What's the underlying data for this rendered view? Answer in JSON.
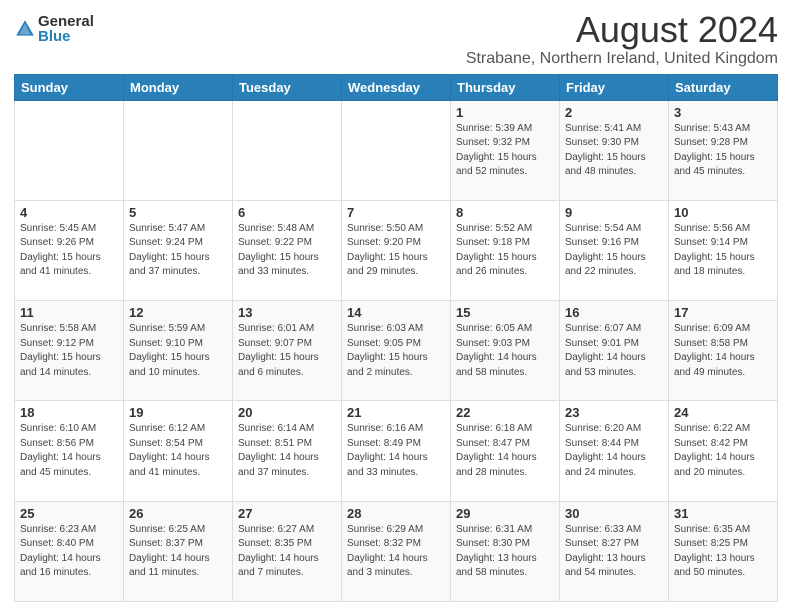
{
  "logo": {
    "general": "General",
    "blue": "Blue"
  },
  "header": {
    "title": "August 2024",
    "subtitle": "Strabane, Northern Ireland, United Kingdom"
  },
  "weekdays": [
    "Sunday",
    "Monday",
    "Tuesday",
    "Wednesday",
    "Thursday",
    "Friday",
    "Saturday"
  ],
  "weeks": [
    [
      {
        "day": "",
        "info": ""
      },
      {
        "day": "",
        "info": ""
      },
      {
        "day": "",
        "info": ""
      },
      {
        "day": "",
        "info": ""
      },
      {
        "day": "1",
        "info": "Sunrise: 5:39 AM\nSunset: 9:32 PM\nDaylight: 15 hours\nand 52 minutes."
      },
      {
        "day": "2",
        "info": "Sunrise: 5:41 AM\nSunset: 9:30 PM\nDaylight: 15 hours\nand 48 minutes."
      },
      {
        "day": "3",
        "info": "Sunrise: 5:43 AM\nSunset: 9:28 PM\nDaylight: 15 hours\nand 45 minutes."
      }
    ],
    [
      {
        "day": "4",
        "info": "Sunrise: 5:45 AM\nSunset: 9:26 PM\nDaylight: 15 hours\nand 41 minutes."
      },
      {
        "day": "5",
        "info": "Sunrise: 5:47 AM\nSunset: 9:24 PM\nDaylight: 15 hours\nand 37 minutes."
      },
      {
        "day": "6",
        "info": "Sunrise: 5:48 AM\nSunset: 9:22 PM\nDaylight: 15 hours\nand 33 minutes."
      },
      {
        "day": "7",
        "info": "Sunrise: 5:50 AM\nSunset: 9:20 PM\nDaylight: 15 hours\nand 29 minutes."
      },
      {
        "day": "8",
        "info": "Sunrise: 5:52 AM\nSunset: 9:18 PM\nDaylight: 15 hours\nand 26 minutes."
      },
      {
        "day": "9",
        "info": "Sunrise: 5:54 AM\nSunset: 9:16 PM\nDaylight: 15 hours\nand 22 minutes."
      },
      {
        "day": "10",
        "info": "Sunrise: 5:56 AM\nSunset: 9:14 PM\nDaylight: 15 hours\nand 18 minutes."
      }
    ],
    [
      {
        "day": "11",
        "info": "Sunrise: 5:58 AM\nSunset: 9:12 PM\nDaylight: 15 hours\nand 14 minutes."
      },
      {
        "day": "12",
        "info": "Sunrise: 5:59 AM\nSunset: 9:10 PM\nDaylight: 15 hours\nand 10 minutes."
      },
      {
        "day": "13",
        "info": "Sunrise: 6:01 AM\nSunset: 9:07 PM\nDaylight: 15 hours\nand 6 minutes."
      },
      {
        "day": "14",
        "info": "Sunrise: 6:03 AM\nSunset: 9:05 PM\nDaylight: 15 hours\nand 2 minutes."
      },
      {
        "day": "15",
        "info": "Sunrise: 6:05 AM\nSunset: 9:03 PM\nDaylight: 14 hours\nand 58 minutes."
      },
      {
        "day": "16",
        "info": "Sunrise: 6:07 AM\nSunset: 9:01 PM\nDaylight: 14 hours\nand 53 minutes."
      },
      {
        "day": "17",
        "info": "Sunrise: 6:09 AM\nSunset: 8:58 PM\nDaylight: 14 hours\nand 49 minutes."
      }
    ],
    [
      {
        "day": "18",
        "info": "Sunrise: 6:10 AM\nSunset: 8:56 PM\nDaylight: 14 hours\nand 45 minutes."
      },
      {
        "day": "19",
        "info": "Sunrise: 6:12 AM\nSunset: 8:54 PM\nDaylight: 14 hours\nand 41 minutes."
      },
      {
        "day": "20",
        "info": "Sunrise: 6:14 AM\nSunset: 8:51 PM\nDaylight: 14 hours\nand 37 minutes."
      },
      {
        "day": "21",
        "info": "Sunrise: 6:16 AM\nSunset: 8:49 PM\nDaylight: 14 hours\nand 33 minutes."
      },
      {
        "day": "22",
        "info": "Sunrise: 6:18 AM\nSunset: 8:47 PM\nDaylight: 14 hours\nand 28 minutes."
      },
      {
        "day": "23",
        "info": "Sunrise: 6:20 AM\nSunset: 8:44 PM\nDaylight: 14 hours\nand 24 minutes."
      },
      {
        "day": "24",
        "info": "Sunrise: 6:22 AM\nSunset: 8:42 PM\nDaylight: 14 hours\nand 20 minutes."
      }
    ],
    [
      {
        "day": "25",
        "info": "Sunrise: 6:23 AM\nSunset: 8:40 PM\nDaylight: 14 hours\nand 16 minutes."
      },
      {
        "day": "26",
        "info": "Sunrise: 6:25 AM\nSunset: 8:37 PM\nDaylight: 14 hours\nand 11 minutes."
      },
      {
        "day": "27",
        "info": "Sunrise: 6:27 AM\nSunset: 8:35 PM\nDaylight: 14 hours\nand 7 minutes."
      },
      {
        "day": "28",
        "info": "Sunrise: 6:29 AM\nSunset: 8:32 PM\nDaylight: 14 hours\nand 3 minutes."
      },
      {
        "day": "29",
        "info": "Sunrise: 6:31 AM\nSunset: 8:30 PM\nDaylight: 13 hours\nand 58 minutes."
      },
      {
        "day": "30",
        "info": "Sunrise: 6:33 AM\nSunset: 8:27 PM\nDaylight: 13 hours\nand 54 minutes."
      },
      {
        "day": "31",
        "info": "Sunrise: 6:35 AM\nSunset: 8:25 PM\nDaylight: 13 hours\nand 50 minutes."
      }
    ]
  ]
}
